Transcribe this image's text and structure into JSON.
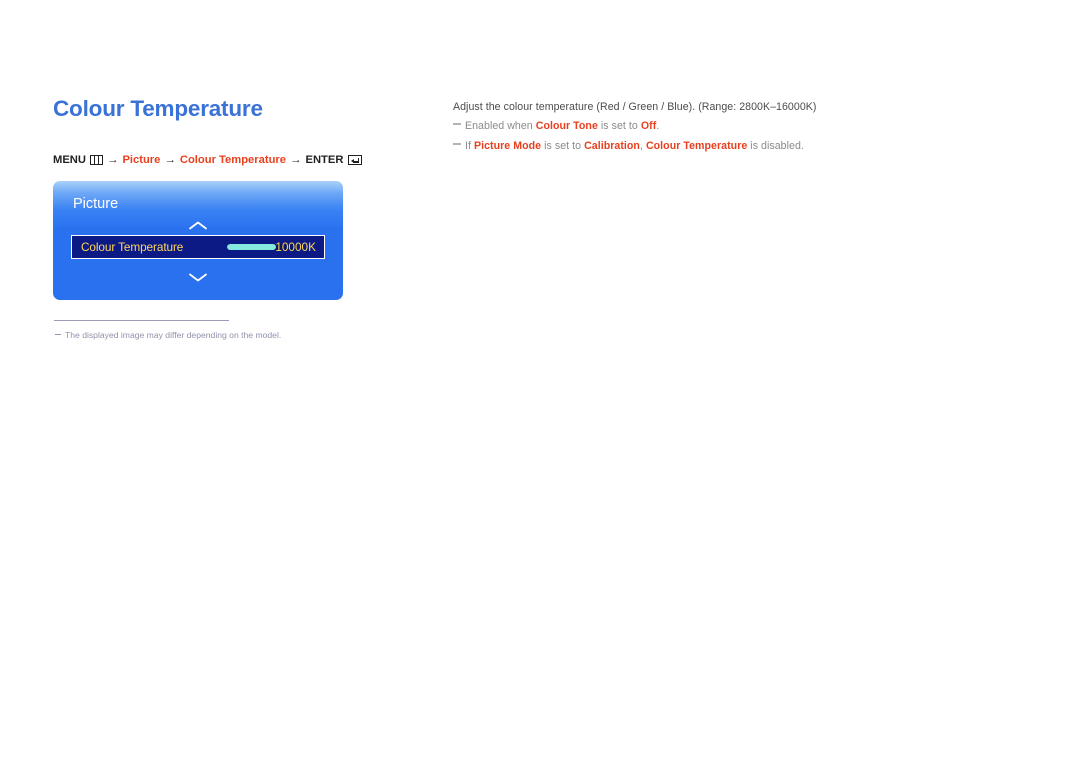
{
  "page": {
    "title": "Colour Temperature"
  },
  "breadcrumb": {
    "menu_label": "MENU",
    "menu_icon": "menu-grid-icon",
    "arrow": "→",
    "step_picture": "Picture",
    "step_colour_temperature": "Colour Temperature",
    "enter_label": "ENTER",
    "enter_icon": "enter-return-icon"
  },
  "osd": {
    "title": "Picture",
    "scroll_up_icon": "chevron-up-icon",
    "scroll_down_icon": "chevron-down-icon",
    "row": {
      "label": "Colour Temperature",
      "value": "10000K",
      "slider_percent": 70
    }
  },
  "footnote": {
    "text": "The displayed image may differ depending on the model."
  },
  "description": {
    "line1": "Adjust the colour temperature (Red / Green / Blue). (Range: 2800K–16000K)",
    "notes": [
      {
        "parts": [
          {
            "text": "Enabled when ",
            "style": "plain"
          },
          {
            "text": "Colour Tone",
            "style": "accent"
          },
          {
            "text": " is set to ",
            "style": "plain"
          },
          {
            "text": "Off",
            "style": "accent"
          },
          {
            "text": ".",
            "style": "plain"
          }
        ]
      },
      {
        "parts": [
          {
            "text": "If ",
            "style": "plain"
          },
          {
            "text": "Picture Mode",
            "style": "accent"
          },
          {
            "text": " is set to ",
            "style": "plain"
          },
          {
            "text": "Calibration",
            "style": "accent"
          },
          {
            "text": ", ",
            "style": "plain"
          },
          {
            "text": "Colour Temperature",
            "style": "accent"
          },
          {
            "text": " is disabled.",
            "style": "plain"
          }
        ]
      }
    ]
  },
  "colors": {
    "title_blue": "#3a72d8",
    "accent_red": "#e8401f",
    "osd_blue": "#2a71f0",
    "osd_row_navy": "#0c1a86",
    "osd_gold": "#ffd65c",
    "slider_cyan": "#85e9e0",
    "body_text": "#4c4c4c",
    "note_text": "#8b8b8b",
    "footnote_text": "#9093ab"
  }
}
